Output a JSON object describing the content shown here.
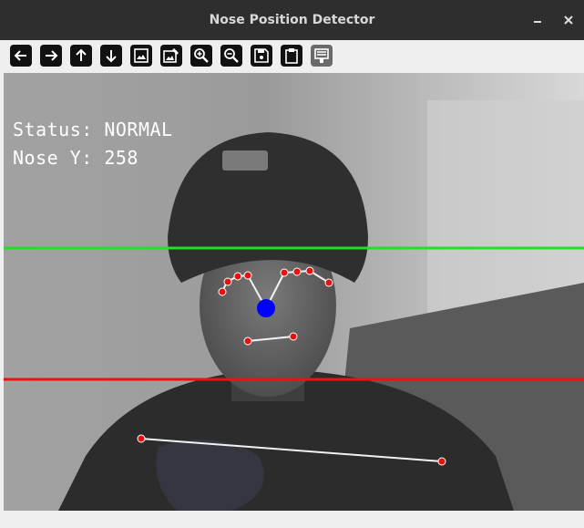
{
  "window": {
    "title": "Nose Position Detector",
    "minimize_icon": "minimize-icon",
    "close_icon": "close-icon"
  },
  "toolbar": {
    "buttons": [
      {
        "icon": "arrow-left-icon",
        "enabled": true
      },
      {
        "icon": "arrow-right-icon",
        "enabled": true
      },
      {
        "icon": "arrow-up-icon",
        "enabled": true
      },
      {
        "icon": "arrow-down-icon",
        "enabled": true
      },
      {
        "icon": "image-icon",
        "enabled": true
      },
      {
        "icon": "image-edit-icon",
        "enabled": true
      },
      {
        "icon": "zoom-in-icon",
        "enabled": true
      },
      {
        "icon": "zoom-out-icon",
        "enabled": true
      },
      {
        "icon": "save-icon",
        "enabled": true
      },
      {
        "icon": "clipboard-icon",
        "enabled": true
      },
      {
        "icon": "properties-icon",
        "enabled": false
      }
    ]
  },
  "overlay": {
    "status_text": "Status: NORMAL",
    "nose_text": "Nose Y: 258"
  },
  "colors": {
    "upper_line": "#22e022",
    "lower_line": "#ee1111",
    "nose_marker": "#0000ff",
    "landmark_dot": "#e81010",
    "skeleton_line": "#f2f2f2"
  }
}
